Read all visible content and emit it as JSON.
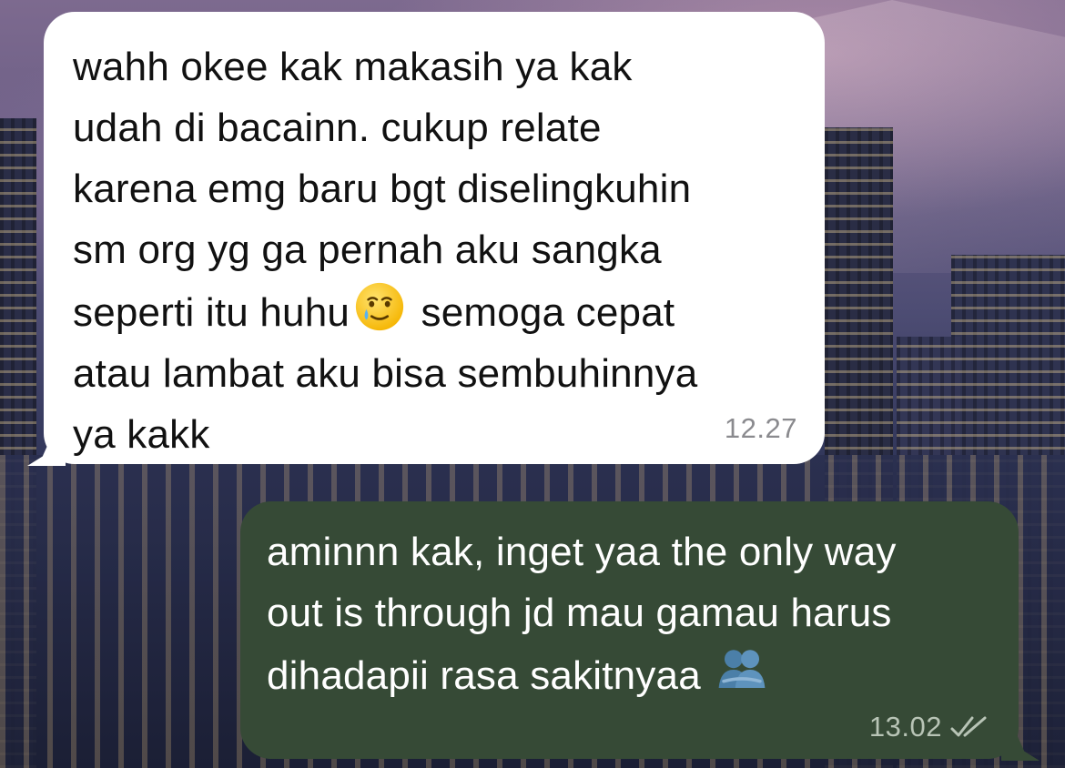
{
  "chat": {
    "incoming": {
      "text": "wahh okee kak makasih ya kak\nudah di bacainn. cukup relate\nkarena emg baru bgt diselingkuhin\nsm org yg ga pernah aku sangka\nseperti itu huhu",
      "text_after_emoji": "semoga cepat\natau lambat aku bisa sembuhinnya\nya kakk",
      "emoji": "crying-smile-emoji",
      "time": "12.27",
      "bubble_color": "#ffffff"
    },
    "outgoing": {
      "text": "aminnn kak, inget yaa the only way\nout is through jd mau gamau harus\ndihadapii rasa sakitnyaa",
      "emoji": "people-hugging-emoji",
      "time": "13.02",
      "status": "read-double-check-icon",
      "bubble_color": "#364a36"
    }
  }
}
